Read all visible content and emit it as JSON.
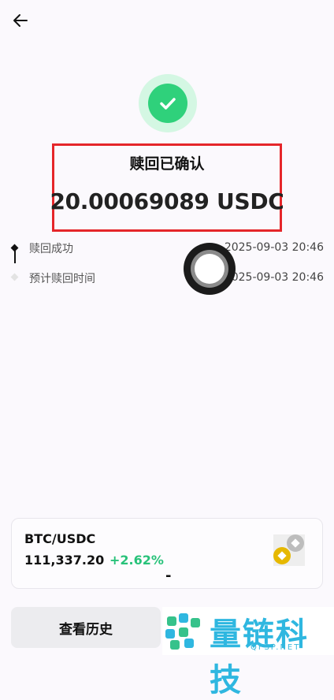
{
  "header": {
    "back_icon": "arrow-left-icon"
  },
  "status": {
    "icon": "check-circle-icon",
    "title": "赎回已确认",
    "amount": "20.00069089 USDC",
    "colors": {
      "success": "#2fd17b",
      "highlight_box": "#e5262a"
    }
  },
  "timeline": [
    {
      "label": "赎回成功",
      "time": "2025-09-03 20:46",
      "state": "done"
    },
    {
      "label": "预计赎回时间",
      "time": "2025-09-03 20:46",
      "state": "pending"
    }
  ],
  "floating_button": {
    "icon": "assistive-touch-icon"
  },
  "market": {
    "pair": "BTC/USDC",
    "price": "111,337.20",
    "change": "+2.62%",
    "change_color": "#28c27a",
    "icon": "coin-swap-icon",
    "dash": "-"
  },
  "footer": {
    "history_button": "查看历史"
  },
  "watermark": {
    "text": "量链科技",
    "sub": "QFSP.NET"
  }
}
